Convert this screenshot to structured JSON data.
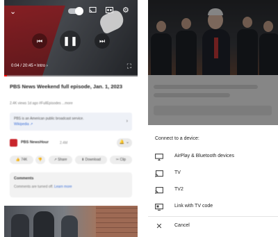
{
  "left_screen": {
    "player": {
      "time": "0:04 / 20:45 • Intro ›",
      "progress": 0.003,
      "accent": "#ff0000"
    },
    "video_title": "PBS News Weekend full episode, Jan. 1, 2023",
    "video_meta": "2.4K views  1d ago  #FullEpisodes  ...more",
    "info_box": {
      "line1": "PBS is an American public broadcast service.",
      "link": "Wikipedia ↗"
    },
    "channel": {
      "name": "PBS NewsHour",
      "subs": "2.4M",
      "subscribe_label": "🔔 ⌄"
    },
    "chips": [
      "👍 74K",
      "👎",
      "↗ Share",
      "⬇ Download",
      "✂ Clip"
    ],
    "comments": {
      "heading": "Comments",
      "body": "Comments are turned off.",
      "link": "Learn more"
    }
  },
  "right_screen": {
    "sheet_title": "Connect to a device:",
    "devices": [
      {
        "label": "AirPlay & Bluetooth devices",
        "icon": "airplay-icon"
      },
      {
        "label": "TV",
        "icon": "cast-icon"
      },
      {
        "label": "TV2",
        "icon": "cast-icon"
      },
      {
        "label": "Link with TV code",
        "icon": "tv-code-icon"
      }
    ],
    "cancel_label": "Cancel"
  }
}
